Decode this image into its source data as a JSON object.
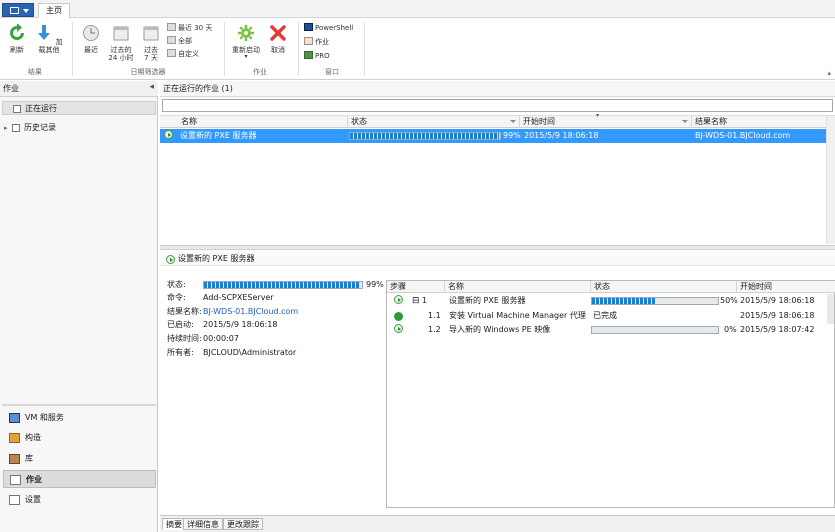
{
  "ribbon": {
    "tab_home": "主页",
    "results": {
      "refresh": "刷新",
      "load_more": "加载其他",
      "group": "结果"
    },
    "date_filter": {
      "recent": "最近",
      "past_24_line1": "过去的",
      "past_24_line2": "24 小时",
      "past_7_line1": "过去",
      "past_7_line2": "7 天",
      "last_30": "最近 30 天",
      "all": "全部",
      "custom": "自定义",
      "group": "日期筛选器"
    },
    "jobs": {
      "restart": "重新启动",
      "cancel": "取消",
      "group": "作业"
    },
    "window": {
      "powershell": "PowerShell",
      "jobs": "作业",
      "pro": "PRO",
      "group": "窗口"
    }
  },
  "nav": {
    "header": "作业",
    "tree": [
      {
        "label": "正在运行"
      },
      {
        "label": "历史记录"
      }
    ],
    "workspaces": [
      {
        "label": "VM 和服务"
      },
      {
        "label": "构造"
      },
      {
        "label": "库"
      },
      {
        "label": "作业"
      },
      {
        "label": "设置"
      }
    ]
  },
  "jobs": {
    "header": "正在运行的作业 (1)",
    "columns": [
      "名称",
      "状态",
      "开始时间",
      "结果名称"
    ],
    "row": {
      "name": "设置新的 PXE 服务器",
      "progress": 99,
      "progress_text": "99%",
      "start": "2015/5/9 18:06:18",
      "result": "BJ-WDS-01.BJCloud.com"
    }
  },
  "detail": {
    "title": "设置新的 PXE 服务器",
    "status_label": "状态:",
    "status_progress": 99,
    "status_text": "99%",
    "fields": [
      {
        "k": "命令:",
        "v": "Add-SCPXEServer"
      },
      {
        "k": "结果名称:",
        "v": "BJ-WDS-01.BJCloud.com"
      },
      {
        "k": "已启动:",
        "v": "2015/5/9 18:06:18"
      },
      {
        "k": "持续时间:",
        "v": "00:00:07"
      },
      {
        "k": "所有者:",
        "v": "BJCLOUD\\Administrator"
      }
    ],
    "step_columns": [
      "步骤",
      "名称",
      "状态",
      "开始时间"
    ],
    "steps": [
      {
        "num": "1",
        "name": "设置新的 PXE 服务器",
        "progress": 50,
        "status_text": "50%",
        "start": "2015/5/9 18:06:18"
      },
      {
        "num": "1.1",
        "name": "安装 Virtual Machine Manager 代理",
        "status_text": "已完成",
        "start": "2015/5/9 18:06:18"
      },
      {
        "num": "1.2",
        "name": "导入新的 Windows PE 映像",
        "progress": 0,
        "status_text": "0%",
        "start": "2015/5/9 18:07:42"
      }
    ]
  },
  "bottom_tabs": [
    "摘要",
    "详细信息",
    "更改跟踪"
  ],
  "colors": {
    "selection": "#3399ff",
    "accent": "#2a63b4"
  }
}
